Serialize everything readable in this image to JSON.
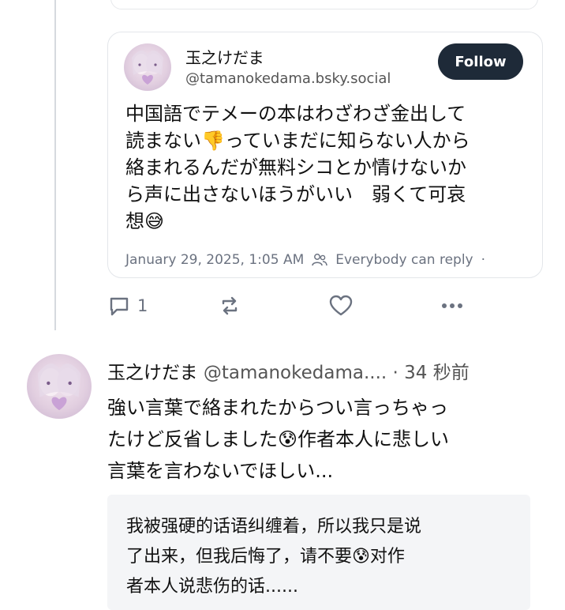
{
  "quoted_post": {
    "author_name": "玉之けだま",
    "author_handle": "@tamanokedama.bsky.social",
    "follow_label": "Follow",
    "text": "中国語でテメーの本はわざわざ金出して\n読まない👎っていまだに知らない人から\n絡まれるんだが無料シコとか情けないか\nら声に出さないほうがいい　弱くて可哀\n想😅",
    "timestamp": "January 29, 2025, 1:05 AM",
    "reply_setting": "Everybody can reply",
    "meta_separator": "·"
  },
  "actions": {
    "reply_count": "1",
    "icons": [
      "reply-icon",
      "repost-icon",
      "like-icon",
      "more-icon"
    ]
  },
  "reply_post": {
    "author_name": "玉之けだま",
    "author_handle": "@tamanokedama....",
    "time_ago": "· 34 秒前",
    "text": "強い言葉で絡まれたからつい言っちゃっ\nたけど反省しました😰作者本人に悲しい\n言葉を言わないでほしい...",
    "translation": "我被强硬的话语纠缠着，所以我只是说\n了出来，但我后悔了，请不要😰对作\n者本人说悲伤的话......"
  },
  "colors": {
    "follow_bg": "#1e2a38",
    "secondary_text": "#6b7280",
    "border": "#e3e6ea",
    "translation_bg": "#f4f5f7"
  }
}
